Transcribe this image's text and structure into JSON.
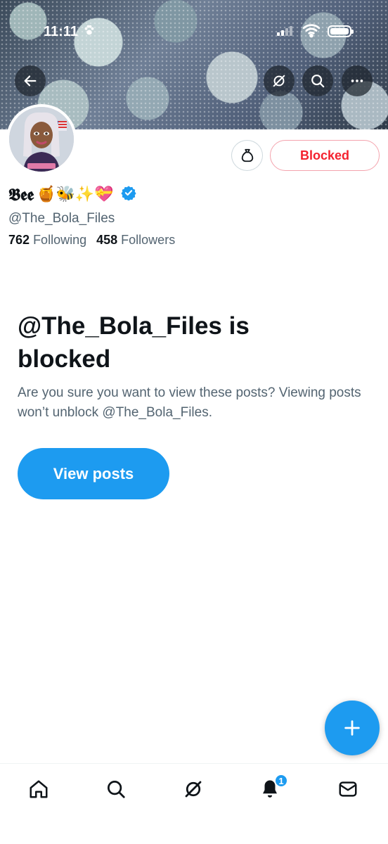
{
  "status_bar": {
    "time": "11:11"
  },
  "profile": {
    "display_name": "𝕭𝖊𝖊",
    "display_name_emoji": "🍯🐝✨💝",
    "handle": "@The_Bola_Files",
    "following_count": "762",
    "following_label": "Following",
    "followers_count": "458",
    "followers_label": "Followers",
    "verified": true
  },
  "actions": {
    "blocked_label": "Blocked"
  },
  "blocked_notice": {
    "title": "@The_Bola_Files is blocked",
    "description": "Are you sure you want to view these posts? Viewing posts won’t unblock @The_Bola_Files.",
    "button_label": "View posts"
  },
  "bottom_nav": {
    "notification_badge": "1"
  },
  "colors": {
    "accent": "#1d9bf0",
    "blocked_red": "#f4212e",
    "secondary_text": "#536471"
  }
}
